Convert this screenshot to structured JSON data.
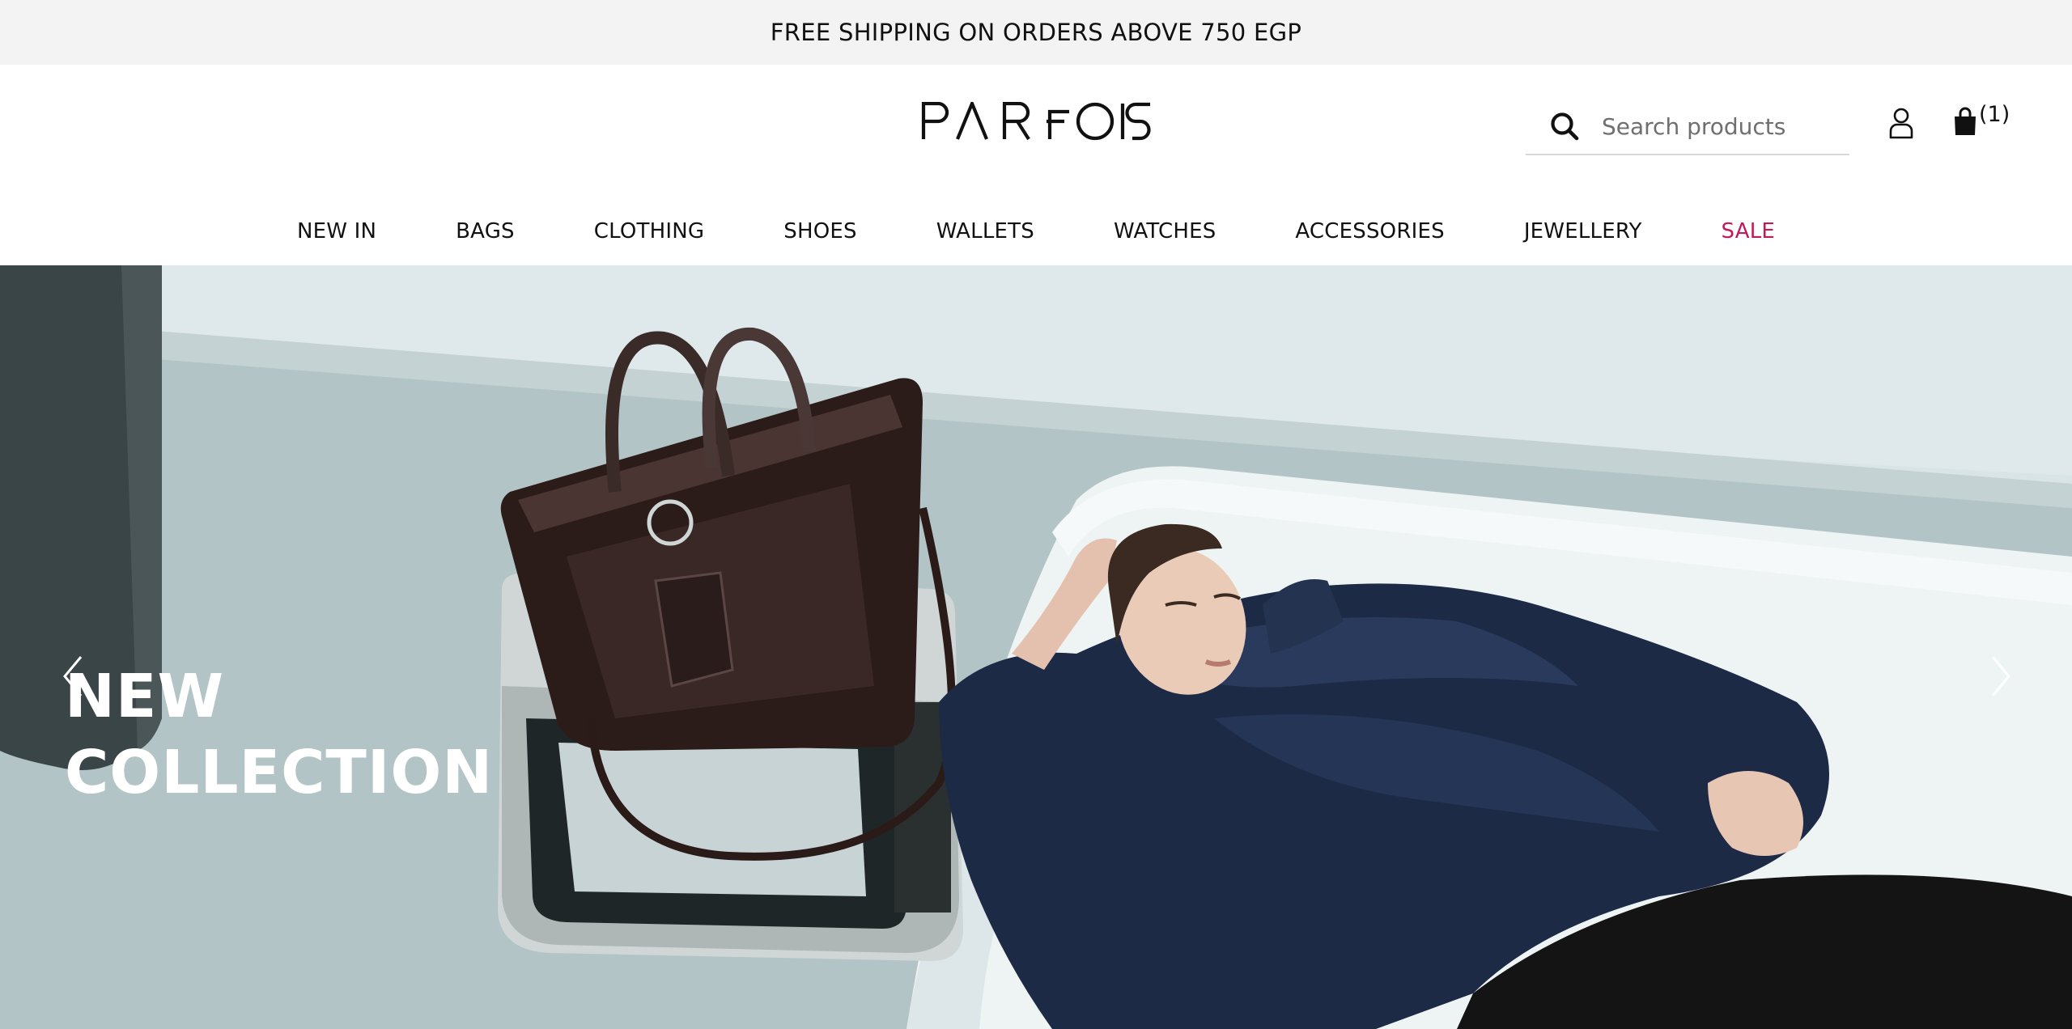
{
  "promo": {
    "text": "FREE SHIPPING ON ORDERS ABOVE 750 EGP"
  },
  "header": {
    "logo_text": "PARFOIS",
    "search": {
      "placeholder": "Search products",
      "icon": "search-icon"
    },
    "account_icon": "user-icon",
    "cart": {
      "icon": "shopping-bag-icon",
      "count": "(1)"
    }
  },
  "nav": {
    "items": [
      {
        "label": "NEW IN"
      },
      {
        "label": "BAGS"
      },
      {
        "label": "CLOTHING"
      },
      {
        "label": "SHOES"
      },
      {
        "label": "WALLETS"
      },
      {
        "label": "WATCHES"
      },
      {
        "label": "ACCESSORIES"
      },
      {
        "label": "JEWELLERY"
      },
      {
        "label": "SALE",
        "color": "#c4185c"
      }
    ]
  },
  "hero": {
    "title_line1": "NEW",
    "title_line2": "COLLECTION",
    "prev_icon": "chevron-left-icon",
    "next_icon": "chevron-right-icon"
  }
}
